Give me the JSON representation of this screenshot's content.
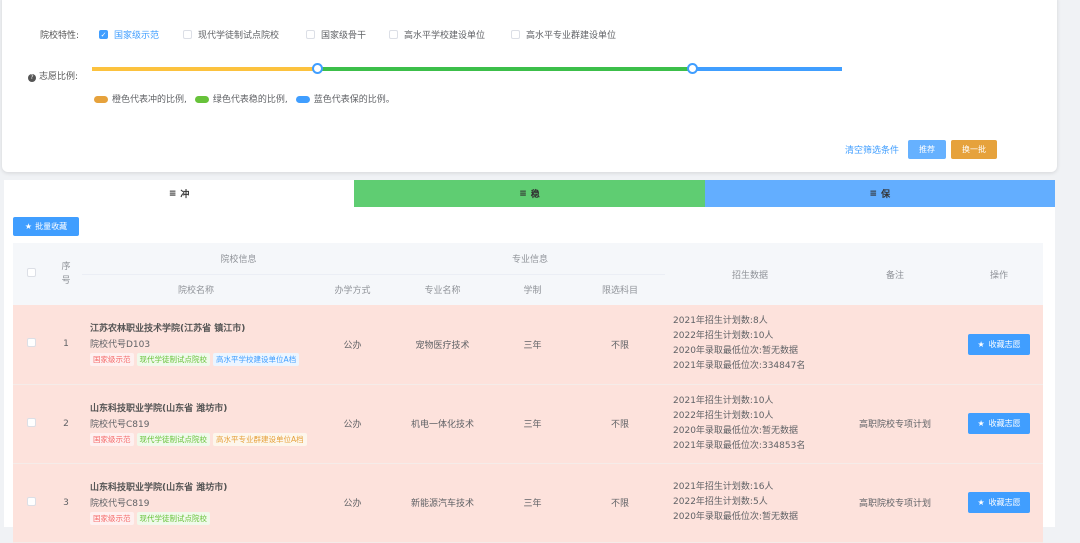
{
  "filters": {
    "feature_label": "院校特性:",
    "options": [
      {
        "label": "国家级示范",
        "checked": true
      },
      {
        "label": "现代学徒制试点院校",
        "checked": false
      },
      {
        "label": "国家级骨干",
        "checked": false
      },
      {
        "label": "高水平学校建设单位",
        "checked": false
      },
      {
        "label": "高水平专业群建设单位",
        "checked": false
      }
    ]
  },
  "ratio": {
    "label": "志愿比例:",
    "chong_pct": 30,
    "wen_pct": 50,
    "bao_pct": 20,
    "legend": [
      "橙色代表冲的比例,",
      "绿色代表稳的比例,",
      "蓝色代表保的比例。"
    ],
    "colors": [
      "#fcc23e",
      "#3cbf4a",
      "#409eff"
    ]
  },
  "actions": {
    "clear": "清空筛选条件",
    "recommend": "推荐",
    "refresh": "换一批"
  },
  "tabs": [
    {
      "label": "冲",
      "icon": "≡"
    },
    {
      "label": "稳",
      "icon": "≡"
    },
    {
      "label": "保",
      "icon": "≡"
    }
  ],
  "batch_button": "批量收藏",
  "table": {
    "group_school": "院校信息",
    "group_major": "专业信息",
    "seq": "序号",
    "school_name": "院校名称",
    "type": "办学方式",
    "major": "专业名称",
    "duration": "学制",
    "subjects": "限选科目",
    "stats": "招生数据",
    "note": "备注",
    "op": "操作",
    "rows": [
      {
        "seq": "1",
        "name": "江苏农林职业技术学院(江苏省 镇江市)",
        "code": "院校代号D103",
        "tags": [
          {
            "text": "国家级示范",
            "color": "red"
          },
          {
            "text": "现代学徒制试点院校",
            "color": "green"
          },
          {
            "text": "高水平学校建设单位A档",
            "color": "blue"
          }
        ],
        "type": "公办",
        "major": "宠物医疗技术",
        "duration": "三年",
        "subjects": "不限",
        "stats": [
          "2021年招生计划数:8人",
          "2022年招生计划数:10人",
          "2020年录取最低位次:暂无数据",
          "2021年录取最低位次:334847名"
        ],
        "note": "",
        "button": "收藏志愿"
      },
      {
        "seq": "2",
        "name": "山东科技职业学院(山东省 潍坊市)",
        "code": "院校代号C819",
        "tags": [
          {
            "text": "国家级示范",
            "color": "red"
          },
          {
            "text": "现代学徒制试点院校",
            "color": "green"
          },
          {
            "text": "高水平专业群建设单位A档",
            "color": "orange"
          }
        ],
        "type": "公办",
        "major": "机电一体化技术",
        "duration": "三年",
        "subjects": "不限",
        "stats": [
          "2021年招生计划数:10人",
          "2022年招生计划数:10人",
          "2020年录取最低位次:暂无数据",
          "2021年录取最低位次:334853名"
        ],
        "note": "高职院校专项计划",
        "button": "收藏志愿"
      },
      {
        "seq": "3",
        "name": "山东科技职业学院(山东省 潍坊市)",
        "code": "院校代号C819",
        "tags": [
          {
            "text": "国家级示范",
            "color": "red"
          },
          {
            "text": "现代学徒制试点院校",
            "color": "green"
          }
        ],
        "type": "公办",
        "major": "新能源汽车技术",
        "duration": "三年",
        "subjects": "不限",
        "stats": [
          "2021年招生计划数:16人",
          "2022年招生计划数:5人",
          "2020年录取最低位次:暂无数据"
        ],
        "note": "高职院校专项计划",
        "button": "收藏志愿"
      }
    ]
  }
}
